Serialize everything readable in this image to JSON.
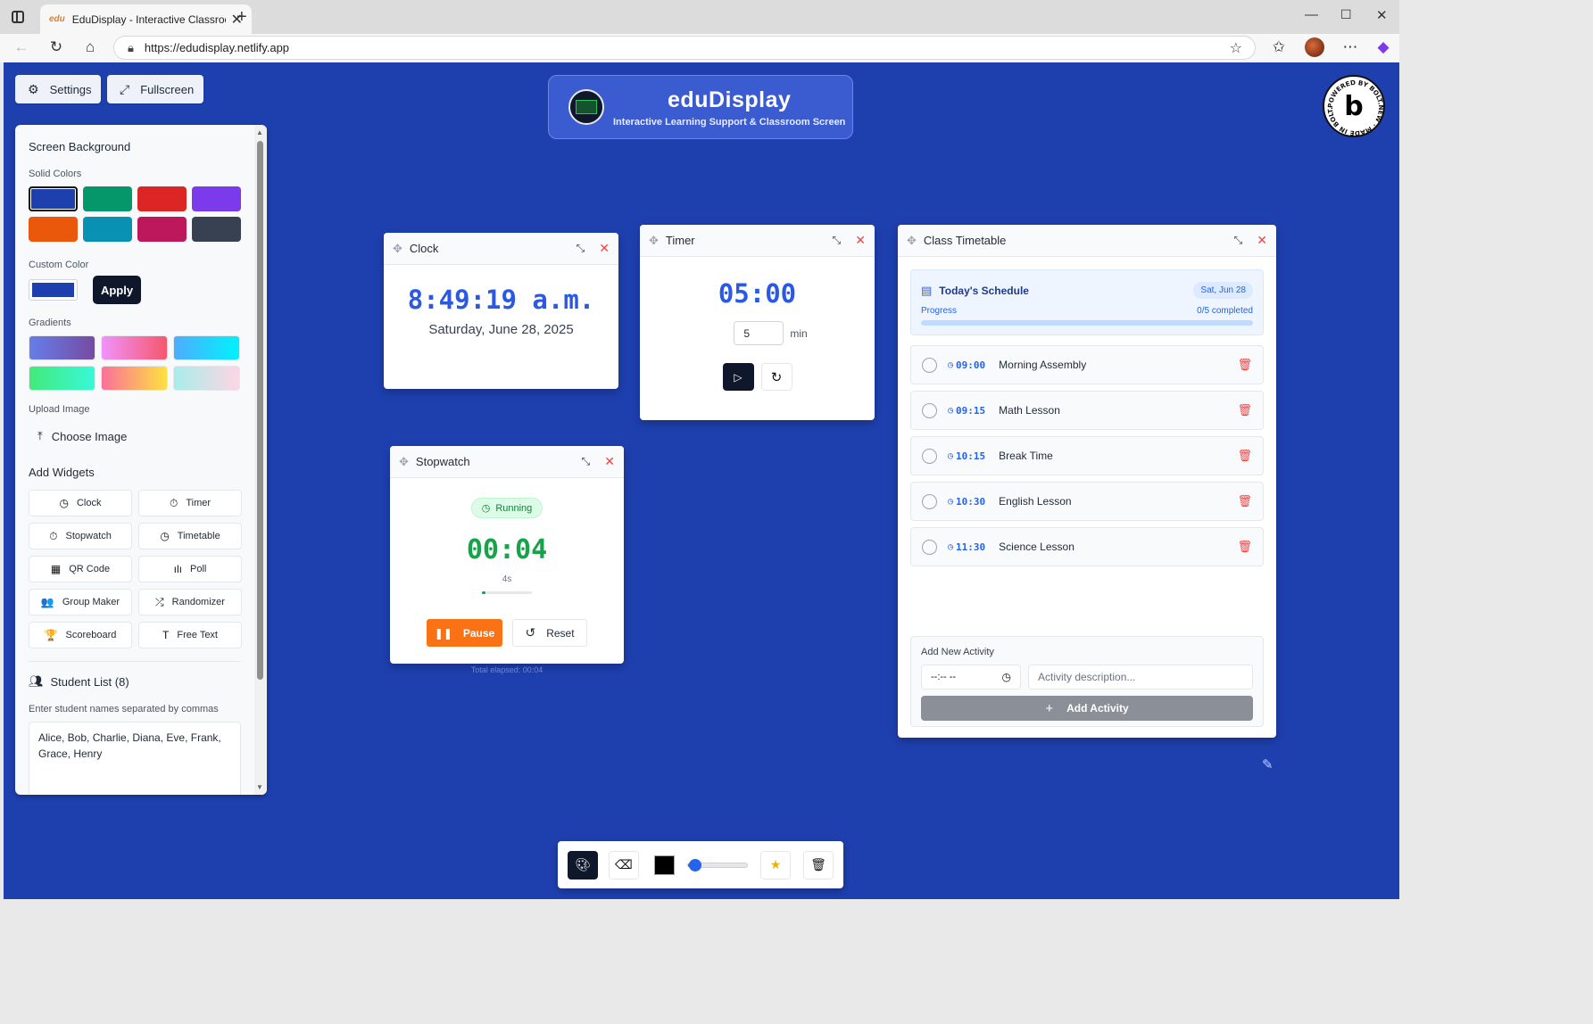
{
  "browser": {
    "tab_title": "EduDisplay - Interactive Classroom",
    "favicon_text": "edu",
    "url": "https://edudisplay.netlify.app"
  },
  "app": {
    "background_color": "#1e40af",
    "settings_label": "Settings",
    "fullscreen_label": "Fullscreen",
    "title": "eduDisplay",
    "subtitle": "Interactive Learning Support & Classroom Screen",
    "badge_text": "POWERED BY BOLT.NEW · MADE IN BOLT.NEW ·",
    "badge_letter": "b"
  },
  "settings_panel": {
    "heading": "Screen Background",
    "solid_colors_label": "Solid Colors",
    "solid_colors": [
      "#1e40af",
      "#059669",
      "#dc2626",
      "#7c3aed",
      "#ea580c",
      "#0891b2",
      "#be185d",
      "#374151"
    ],
    "custom_color_label": "Custom Color",
    "custom_color_value": "#1e40af",
    "apply_label": "Apply",
    "gradients_label": "Gradients",
    "gradients": [
      "linear-gradient(90deg,#667eea,#764ba2)",
      "linear-gradient(90deg,#f093fb,#f5576c)",
      "linear-gradient(90deg,#4facfe,#00f2fe)",
      "linear-gradient(90deg,#43e97b,#38f9d7)",
      "linear-gradient(90deg,#fa709a,#fee140)",
      "linear-gradient(90deg,#a8edea,#fed6e3)"
    ],
    "upload_label": "Upload Image",
    "choose_image_label": "Choose Image",
    "add_widgets_label": "Add Widgets",
    "widgets": [
      {
        "label": "Clock",
        "icon": "clock-icon",
        "glyph": "◷"
      },
      {
        "label": "Timer",
        "icon": "timer-icon",
        "glyph": "⏱"
      },
      {
        "label": "Stopwatch",
        "icon": "stopwatch-icon",
        "glyph": "⏱"
      },
      {
        "label": "Timetable",
        "icon": "clock-icon",
        "glyph": "◷"
      },
      {
        "label": "QR Code",
        "icon": "qr-code-icon",
        "glyph": "▦"
      },
      {
        "label": "Poll",
        "icon": "bar-chart-icon",
        "glyph": "ılı"
      },
      {
        "label": "Group Maker",
        "icon": "users-icon",
        "glyph": "👥"
      },
      {
        "label": "Randomizer",
        "icon": "shuffle-icon",
        "glyph": "⤮"
      },
      {
        "label": "Scoreboard",
        "icon": "trophy-icon",
        "glyph": "🏆"
      },
      {
        "label": "Free Text",
        "icon": "text-icon",
        "glyph": "T"
      }
    ],
    "student_list_label": "Student List (8)",
    "student_hint": "Enter student names separated by commas",
    "student_names": "Alice, Bob, Charlie, Diana, Eve, Frank, Grace, Henry"
  },
  "clock_widget": {
    "title": "Clock",
    "time": "8:49:19 a.m.",
    "date": "Saturday, June 28, 2025"
  },
  "timer_widget": {
    "title": "Timer",
    "value": "05:00",
    "minutes_input": "5",
    "unit": "min"
  },
  "stopwatch_widget": {
    "title": "Stopwatch",
    "status": "Running",
    "time": "00:04",
    "seconds": "4s",
    "progress": 0.07,
    "pause_label": "Pause",
    "reset_label": "Reset",
    "total_elapsed": "Total elapsed: 00:04"
  },
  "timetable_widget": {
    "title": "Class Timetable",
    "schedule_title": "Today's Schedule",
    "date": "Sat, Jun 28",
    "progress_label": "Progress",
    "progress_text": "0/5 completed",
    "progress": 0,
    "items": [
      {
        "time": "09:00",
        "name": "Morning Assembly"
      },
      {
        "time": "09:15",
        "name": "Math Lesson"
      },
      {
        "time": "10:15",
        "name": "Break Time"
      },
      {
        "time": "10:30",
        "name": "English Lesson"
      },
      {
        "time": "11:30",
        "name": "Science Lesson"
      }
    ],
    "add_title": "Add New Activity",
    "time_placeholder": "--:-- --",
    "desc_placeholder": "Activity description...",
    "add_button": "Add Activity"
  },
  "toolbar": {
    "pen_color": "#000000",
    "brush_size": 0.12
  }
}
